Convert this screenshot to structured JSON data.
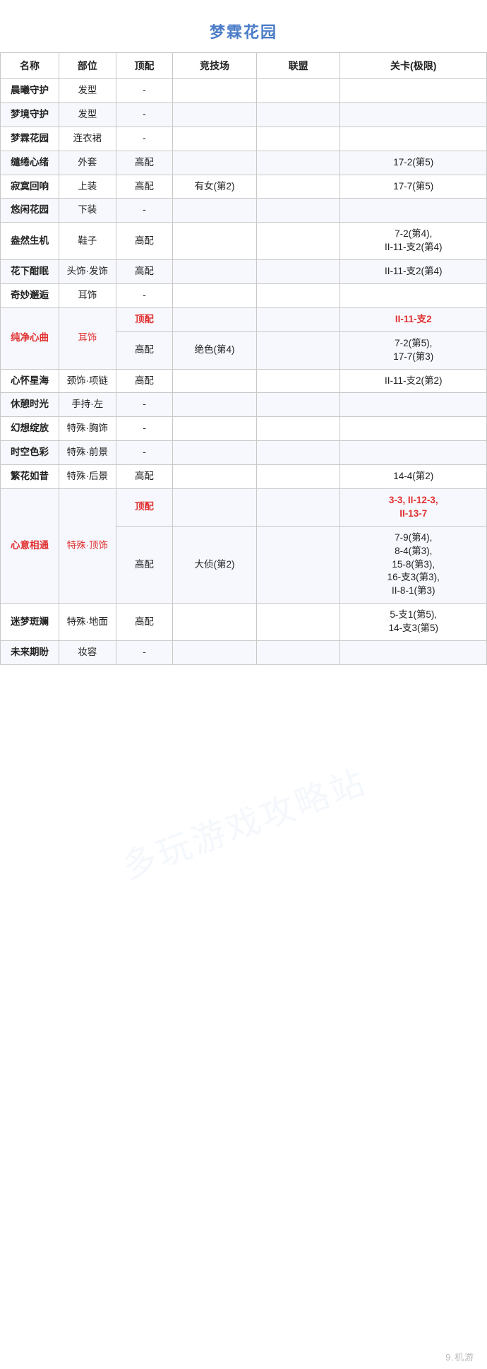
{
  "title": "梦霖花园",
  "watermark": "多玩游戏攻略站",
  "footer": "9.机游",
  "columns": {
    "name": "名称",
    "part": "部位",
    "top": "顶配",
    "arena": "竞技场",
    "league": "联盟",
    "stage": "关卡(极限)"
  },
  "rows": [
    {
      "name": "晨曦守护",
      "part": "发型",
      "top": "-",
      "arena": "",
      "league": "",
      "stage": "",
      "name_red": false,
      "top_red": false,
      "stage_red": false
    },
    {
      "name": "梦境守护",
      "part": "发型",
      "top": "-",
      "arena": "",
      "league": "",
      "stage": "",
      "name_red": false,
      "top_red": false,
      "stage_red": false
    },
    {
      "name": "梦霖花园",
      "part": "连衣裙",
      "top": "-",
      "arena": "",
      "league": "",
      "stage": "",
      "name_red": false,
      "top_red": false,
      "stage_red": false
    },
    {
      "name": "缱绻心绪",
      "part": "外套",
      "top": "高配",
      "arena": "",
      "league": "",
      "stage": "17-2(第5)",
      "name_red": false,
      "top_red": false,
      "stage_red": false
    },
    {
      "name": "寂寞回响",
      "part": "上装",
      "top": "高配",
      "arena": "有女(第2)",
      "league": "",
      "stage": "17-7(第5)",
      "name_red": false,
      "top_red": false,
      "stage_red": false
    },
    {
      "name": "悠闲花园",
      "part": "下装",
      "top": "-",
      "arena": "",
      "league": "",
      "stage": "",
      "name_red": false,
      "top_red": false,
      "stage_red": false
    },
    {
      "name": "盎然生机",
      "part": "鞋子",
      "top": "高配",
      "arena": "",
      "league": "",
      "stage": "7-2(第4),\nII-11-支2(第4)",
      "name_red": false,
      "top_red": false,
      "stage_red": false
    },
    {
      "name": "花下酣眠",
      "part": "头饰·发饰",
      "top": "高配",
      "arena": "",
      "league": "",
      "stage": "II-11-支2(第4)",
      "name_red": false,
      "top_red": false,
      "stage_red": false
    },
    {
      "name": "奇妙邂逅",
      "part": "耳饰",
      "top": "-",
      "arena": "",
      "league": "",
      "stage": "",
      "name_red": false,
      "top_red": false,
      "stage_red": false
    },
    {
      "name": "纯净心曲",
      "part": "耳饰",
      "top_row1": "顶配",
      "top_row2": "高配",
      "arena_row1": "",
      "arena_row2": "绝色(第4)",
      "league_row1": "",
      "league_row2": "",
      "stage_row1": "II-11-支2",
      "stage_row2": "7-2(第5),\n17-7(第3)",
      "name_red": true,
      "split_row": true,
      "stage_row1_red": true
    },
    {
      "name": "心怀星海",
      "part": "颈饰·项链",
      "top": "高配",
      "arena": "",
      "league": "",
      "stage": "II-11-支2(第2)",
      "name_red": false,
      "top_red": false,
      "stage_red": false
    },
    {
      "name": "休憩时光",
      "part": "手持·左",
      "top": "-",
      "arena": "",
      "league": "",
      "stage": "",
      "name_red": false,
      "top_red": false,
      "stage_red": false
    },
    {
      "name": "幻想绽放",
      "part": "特殊·胸饰",
      "top": "-",
      "arena": "",
      "league": "",
      "stage": "",
      "name_red": false,
      "top_red": false,
      "stage_red": false
    },
    {
      "name": "时空色彩",
      "part": "特殊·前景",
      "top": "-",
      "arena": "",
      "league": "",
      "stage": "",
      "name_red": false,
      "top_red": false,
      "stage_red": false
    },
    {
      "name": "繁花如昔",
      "part": "特殊·后景",
      "top": "高配",
      "arena": "",
      "league": "",
      "stage": "14-4(第2)",
      "name_red": false,
      "top_red": false,
      "stage_red": false
    },
    {
      "name": "心意相通",
      "part": "特殊·顶饰",
      "top_row1": "顶配",
      "top_row2": "高配",
      "arena_row1": "",
      "arena_row2": "大侦(第2)",
      "league_row1": "",
      "league_row2": "",
      "stage_row1": "3-3, II-12-3,\nII-13-7",
      "stage_row2": "7-9(第4),\n8-4(第3),\n15-8(第3),\n16-支3(第3),\nII-8-1(第3)",
      "name_red": true,
      "split_row": true,
      "stage_row1_red": true
    },
    {
      "name": "迷梦斑斓",
      "part": "特殊·地面",
      "top": "高配",
      "arena": "",
      "league": "",
      "stage": "5-支1(第5),\n14-支3(第5)",
      "name_red": false,
      "top_red": false,
      "stage_red": false
    },
    {
      "name": "未来期盼",
      "part": "妆容",
      "top": "-",
      "arena": "",
      "league": "",
      "stage": "",
      "name_red": false,
      "top_red": false,
      "stage_red": false
    }
  ]
}
